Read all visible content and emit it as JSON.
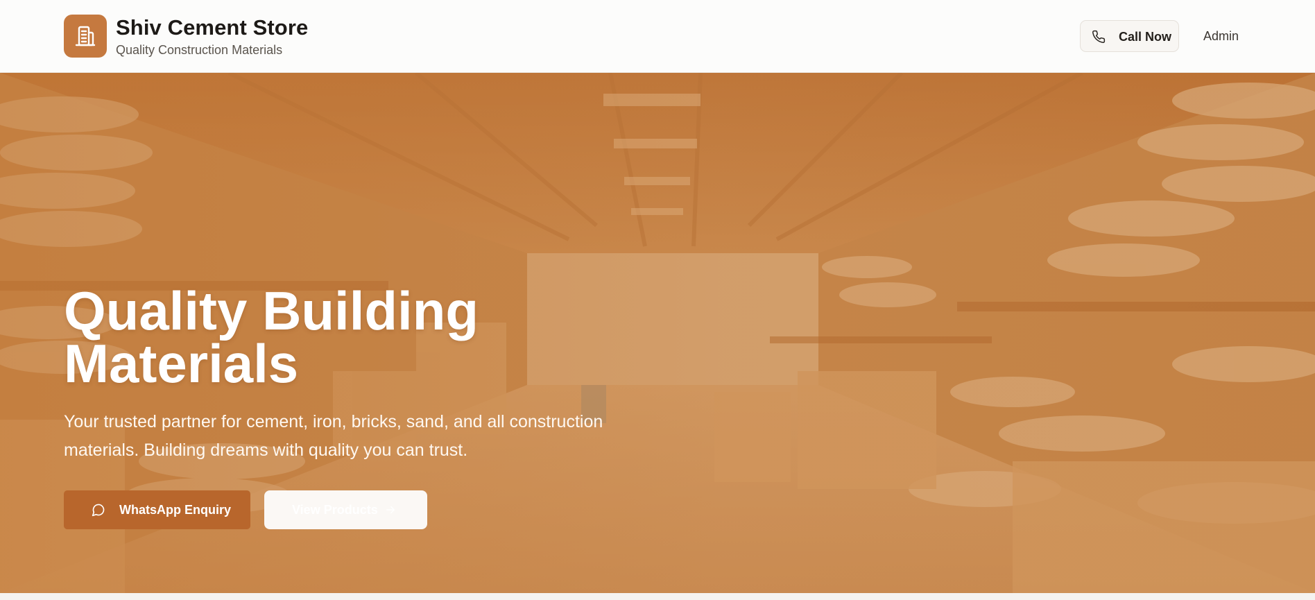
{
  "header": {
    "brand_name": "Shiv Cement Store",
    "brand_tagline": "Quality Construction Materials",
    "logo_icon": "building-icon",
    "call_label": "Call Now",
    "call_icon": "phone-icon",
    "admin_label": "Admin"
  },
  "hero": {
    "background": "warehouse-photo",
    "title": "Quality Building Materials",
    "subtitle": "Your trusted partner for cement, iron, bricks, sand, and all construction materials. Building dreams with quality you can trust.",
    "whatsapp_label": "WhatsApp Enquiry",
    "whatsapp_icon": "chat-bubble-icon",
    "view_products_label": "View Products",
    "view_products_icon": "arrow-right-icon"
  },
  "colors": {
    "accent": "#c5793f",
    "accent_dark": "#b8662c",
    "hero_tint": "#c58548"
  }
}
